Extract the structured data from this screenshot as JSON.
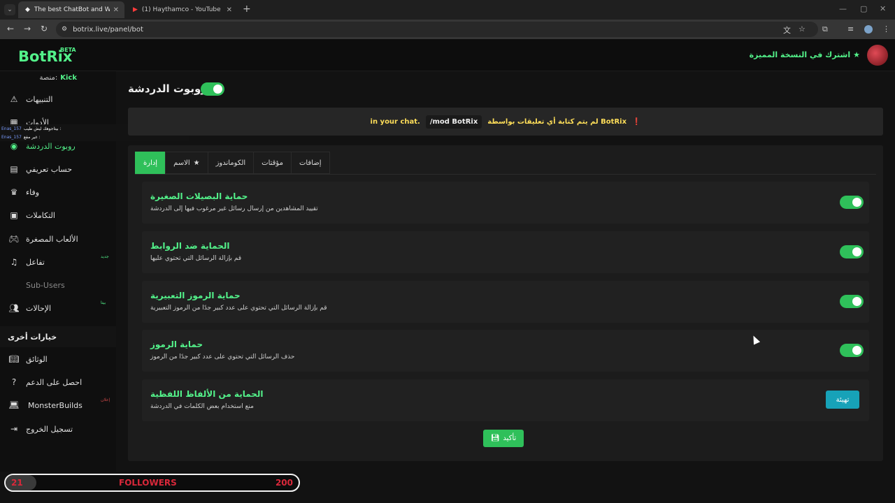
{
  "browser": {
    "tabs": [
      {
        "title": "The best ChatBot and Widgets",
        "close": "✕"
      },
      {
        "title": "(1) Haythamco - YouTube",
        "close": "✕"
      }
    ],
    "url": "botrix.live/panel/bot"
  },
  "header": {
    "logo": "BotRix",
    "logo_badge": "BETA",
    "premium_link": "اشترك في النسخة المميزة"
  },
  "sidebar": {
    "platform_label": "منصة:",
    "platform_value": "Kick",
    "items": [
      {
        "label": "التنبيهات",
        "icon": "warning-icon"
      },
      {
        "label": "الأدوات",
        "icon": "widgets-icon"
      },
      {
        "label": "روبوت الدردشة",
        "icon": "robot-icon"
      },
      {
        "label": "حساب تعريفي",
        "icon": "id-card-icon"
      },
      {
        "label": "وفاء",
        "icon": "trophy-icon"
      },
      {
        "label": "التكاملات",
        "icon": "integrations-icon"
      },
      {
        "label": "الألعاب المصغرة",
        "icon": "gamepad-icon"
      },
      {
        "label": "تفاعل",
        "icon": "music-icon",
        "badge": "جديد"
      },
      {
        "label": "Sub-Users",
        "icon": ""
      },
      {
        "label": "الإحالات",
        "icon": "users-icon",
        "badge": "بيتا"
      }
    ],
    "other_section": "خيارات أخرى",
    "other_items": [
      {
        "label": "الوثائق",
        "icon": "book-icon"
      },
      {
        "label": "احصل على الدعم",
        "icon": "help-icon"
      },
      {
        "label": "MonsterBuilds",
        "icon": "laptop-icon",
        "badge": "إعلان"
      },
      {
        "label": "تسجيل الخروج",
        "icon": "logout-icon"
      }
    ]
  },
  "chat_overlay": [
    {
      "user": "Enas_157",
      "text": "بيتاجوهك ليش طيب :"
    },
    {
      "user": "Enas_157",
      "text": "غير مفع :"
    }
  ],
  "main": {
    "title": "روبوت الدردشة",
    "notice": {
      "text": "لم يتم كتابة أي تعليقات بواسطة BotRix",
      "code": "/mod BotRix",
      "suffix": "in your chat."
    },
    "tabs": [
      "إضافات",
      "مؤقتات",
      "الكوماندوز",
      "الاسم",
      "إدارة"
    ],
    "settings": [
      {
        "title": "حماية البصيلات الصغيرة",
        "desc": "تقييد المشاهدين من إرسال رسائل غير مرغوب فيها إلى الدردشة",
        "enabled": true
      },
      {
        "title": "الحماية ضد الروابط",
        "desc": "قم بإزالة الرسائل التي تحتوي عليها",
        "enabled": true
      },
      {
        "title": "حماية الرموز التعبيرية",
        "desc": "قم بإزالة الرسائل التي تحتوي على عدد كبير جدًا من الرموز التعبيرية",
        "enabled": true
      },
      {
        "title": "حماية الرموز",
        "desc": "حذف الرسائل التي تحتوي على عدد كبير جدًا من الرموز",
        "enabled": true
      },
      {
        "title": "الحماية من الألفاظ اللفظية",
        "desc": "منع استخدام بعض الكلمات في الدردشة",
        "button": "تهيئة"
      }
    ],
    "save_label": "تأكيد"
  },
  "followers": {
    "current": "21",
    "label": "FOLLOWERS",
    "goal": "200",
    "progress": 0.105
  },
  "colors": {
    "accent": "#2fc05a",
    "brand": "#53f28a",
    "notice": "#ffde59",
    "followers": "#d9283a"
  }
}
